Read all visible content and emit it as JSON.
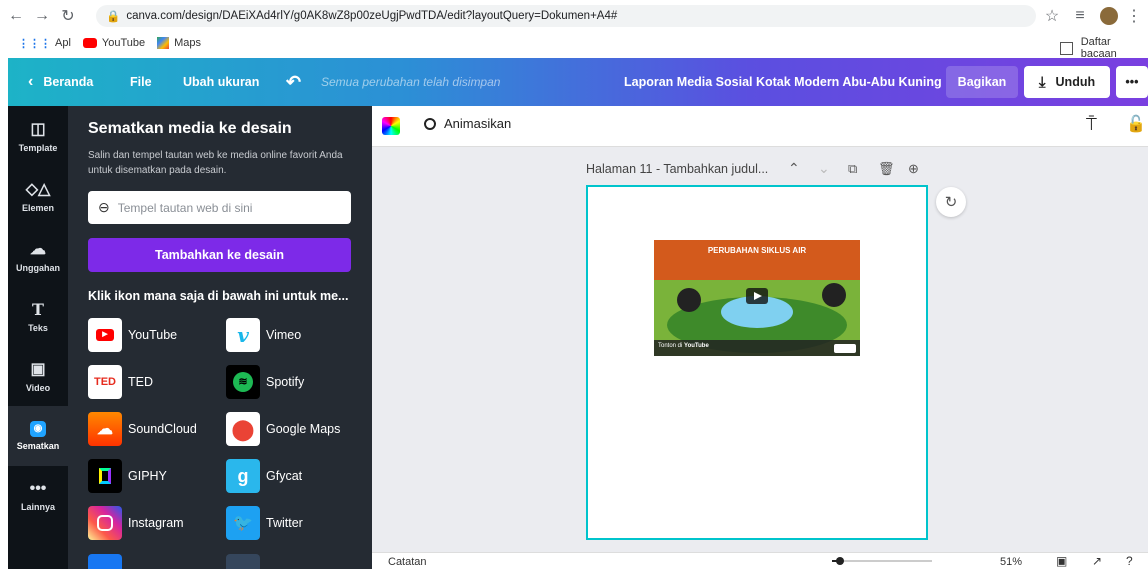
{
  "browser": {
    "url": "canva.com/design/DAEiXAd4rlY/g0AK8wZ8p00zeUgjPwdTDA/edit?layoutQuery=Dokumen+A4#",
    "bookmarks": [
      "Apl",
      "YouTube",
      "Maps"
    ],
    "reading_list": "Daftar bacaan"
  },
  "topbar": {
    "home": "Beranda",
    "file": "File",
    "resize": "Ubah ukuran",
    "saved_status": "Semua perubahan telah disimpan",
    "design_title": "Laporan Media Sosial Kotak Modern Abu-Abu Kuning",
    "share": "Bagikan",
    "download": "Unduh",
    "more": "•••"
  },
  "rail": {
    "items": [
      {
        "label": "Template",
        "icon": "template-icon"
      },
      {
        "label": "Elemen",
        "icon": "elements-icon"
      },
      {
        "label": "Unggahan",
        "icon": "upload-icon"
      },
      {
        "label": "Teks",
        "icon": "text-icon"
      },
      {
        "label": "Video",
        "icon": "video-icon"
      },
      {
        "label": "Sematkan",
        "icon": "embed-icon"
      },
      {
        "label": "Lainnya",
        "icon": "more-icon"
      }
    ]
  },
  "panel": {
    "title": "Sematkan media ke desain",
    "description": "Salin dan tempel tautan web ke media online favorit Anda untuk disematkan pada desain.",
    "link_placeholder": "Tempel tautan web di sini",
    "add_button": "Tambahkan ke desain",
    "icons_heading": "Klik ikon mana saja di bawah ini untuk me...",
    "services": [
      {
        "name": "YouTube",
        "color": "#ff0000"
      },
      {
        "name": "Vimeo",
        "color": "#1ab7ea"
      },
      {
        "name": "TED",
        "color": "#e62b1e"
      },
      {
        "name": "Spotify",
        "color": "#1db954"
      },
      {
        "name": "SoundCloud",
        "color": "#ff5500"
      },
      {
        "name": "Google Maps",
        "color": "#ffffff"
      },
      {
        "name": "GIPHY",
        "color": "#000000"
      },
      {
        "name": "Gfycat",
        "color": "#2ab7ec"
      },
      {
        "name": "Instagram",
        "color": "#d6249f"
      },
      {
        "name": "Twitter",
        "color": "#1da1f2"
      }
    ]
  },
  "editor": {
    "animate": "Animasikan",
    "page_label": "Halaman 11 - Tambahkan judul...",
    "notes": "Catatan",
    "zoom": "51%"
  },
  "video": {
    "title_text": "PERUBAHAN SIKLUS AIR",
    "watch_on": "Tonton di",
    "platform": "YouTube"
  },
  "colors": {
    "accent": "#7d2ae8",
    "frame": "#00c4cc",
    "panel_bg": "#252b33",
    "rail_bg": "#0e1318"
  }
}
